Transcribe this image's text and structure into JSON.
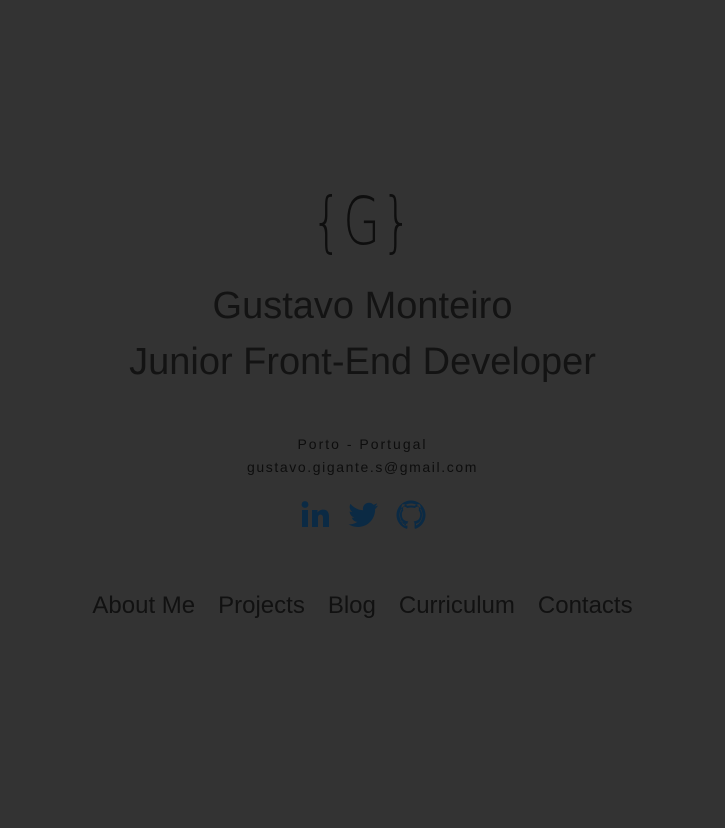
{
  "hero": {
    "logo_text": "{G}",
    "name": "Gustavo Monteiro",
    "role": "Junior Front-End Developer",
    "location": "Porto - Portugal",
    "email": "gustavo.gigante.s@gmail.com"
  },
  "social": {
    "icon_color": "#0b2a44",
    "items": [
      {
        "icon": "linkedin-icon"
      },
      {
        "icon": "twitter-icon"
      },
      {
        "icon": "github-icon"
      }
    ]
  },
  "nav": {
    "items": [
      {
        "label": "About Me"
      },
      {
        "label": "Projects"
      },
      {
        "label": "Blog"
      },
      {
        "label": "Curriculum"
      },
      {
        "label": "Contacts"
      }
    ]
  },
  "theme": {
    "background": "#333333",
    "text": "#111111"
  }
}
